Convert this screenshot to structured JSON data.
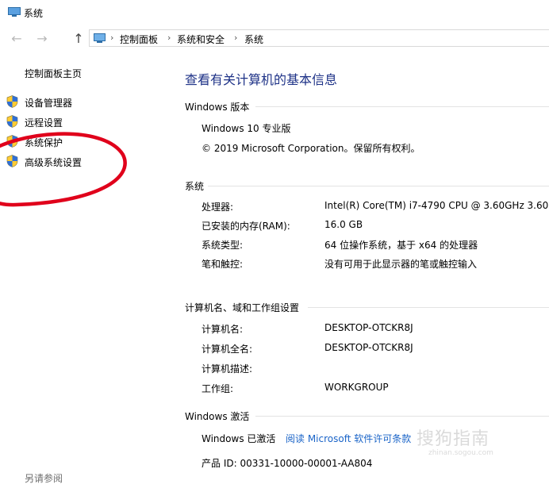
{
  "window": {
    "title": "系统"
  },
  "nav": {
    "back_icon": "arrow-left-icon",
    "forward_icon": "arrow-right-icon",
    "up_icon": "arrow-up-icon",
    "breadcrumb": [
      "控制面板",
      "系统和安全",
      "系统"
    ]
  },
  "sidebar": {
    "home": "控制面板主页",
    "items": [
      {
        "label": "设备管理器",
        "icon": "shield-icon"
      },
      {
        "label": "远程设置",
        "icon": "shield-icon"
      },
      {
        "label": "系统保护",
        "icon": "shield-icon"
      },
      {
        "label": "高级系统设置",
        "icon": "shield-icon"
      }
    ],
    "see_also": "另请参阅"
  },
  "main": {
    "title": "查看有关计算机的基本信息",
    "windows_edition": {
      "heading": "Windows 版本",
      "edition": "Windows 10 专业版",
      "copyright": "© 2019 Microsoft Corporation。保留所有权利。"
    },
    "system": {
      "heading": "系统",
      "rows": [
        {
          "label": "处理器:",
          "value": "Intel(R) Core(TM) i7-4790 CPU @ 3.60GHz   3.60"
        },
        {
          "label": "已安装的内存(RAM):",
          "value": "16.0 GB"
        },
        {
          "label": "系统类型:",
          "value": "64 位操作系统，基于 x64 的处理器"
        },
        {
          "label": "笔和触控:",
          "value": "没有可用于此显示器的笔或触控输入"
        }
      ]
    },
    "computer_name": {
      "heading": "计算机名、域和工作组设置",
      "rows": [
        {
          "label": "计算机名:",
          "value": "DESKTOP-OTCKR8J"
        },
        {
          "label": "计算机全名:",
          "value": "DESKTOP-OTCKR8J"
        },
        {
          "label": "计算机描述:",
          "value": ""
        },
        {
          "label": "工作组:",
          "value": "WORKGROUP"
        }
      ]
    },
    "activation": {
      "heading": "Windows 激活",
      "status": "Windows 已激活",
      "license_link": "阅读 Microsoft 软件许可条款",
      "product_id": "产品 ID: 00331-10000-00001-AA804"
    }
  },
  "colors": {
    "title": "#1e3287",
    "link": "#1a64c8",
    "annotation": "#e0001b"
  },
  "watermark": {
    "text": "搜狗指南",
    "sub": "zhinan.sogou.com"
  }
}
